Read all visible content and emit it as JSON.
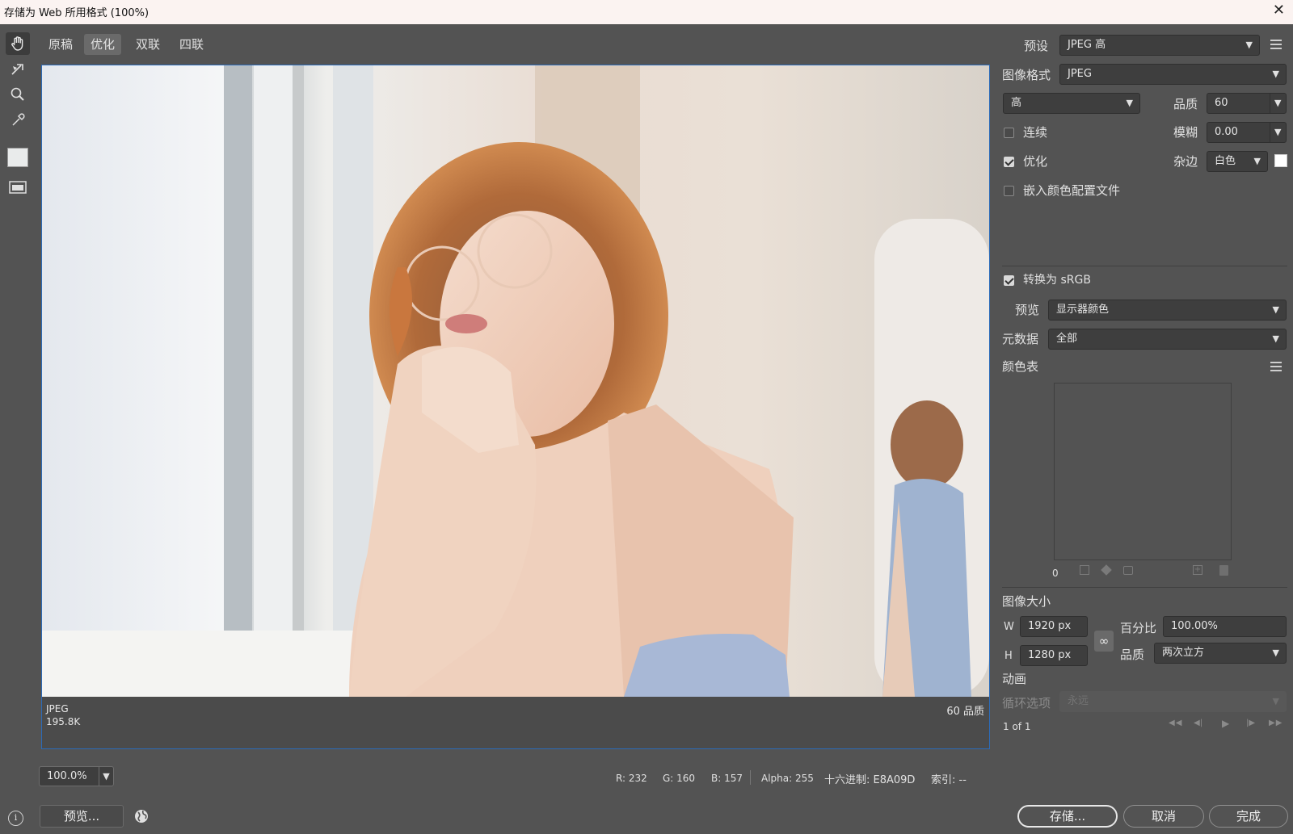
{
  "window": {
    "title": "存储为 Web 所用格式 (100%)",
    "close": "✕"
  },
  "tabs": [
    "原稿",
    "优化",
    "双联",
    "四联"
  ],
  "tools": [
    "hand-icon",
    "slice-select-icon",
    "zoom-icon",
    "eyedropper-icon",
    "eyedropper-color-icon",
    "toggle-slices-icon"
  ],
  "preview": {
    "format": "JPEG",
    "size": "195.8K",
    "quality_text": "60 品质"
  },
  "zoom": {
    "value": "100.0%"
  },
  "status": {
    "r": "R: 232",
    "g": "G: 160",
    "b": "B: 157",
    "alpha": "Alpha: 255",
    "hex": "十六进制: E8A09D",
    "index": "索引: --"
  },
  "settings": {
    "preset_label": "预设",
    "preset_value": "JPEG 高",
    "format_label": "图像格式",
    "format_value": "JPEG",
    "quality_level": "高",
    "quality_label": "品质",
    "quality_value": "60",
    "blur_label": "模糊",
    "blur_value": "0.00",
    "matte_label": "杂边",
    "matte_value": "白色",
    "progressive_label": "连续",
    "progressive_checked": false,
    "optimized_label": "优化",
    "optimized_checked": true,
    "embed_profile_label": "嵌入颜色配置文件",
    "embed_profile_checked": false,
    "convert_srgb_label": "转换为 sRGB",
    "convert_srgb_checked": true,
    "preview_label": "预览",
    "preview_value": "显示器颜色",
    "metadata_label": "元数据",
    "metadata_value": "全部",
    "color_table_label": "颜色表",
    "color_table_count": "0"
  },
  "image_size": {
    "label": "图像大小",
    "w_label": "W",
    "w_value": "1920 px",
    "h_label": "H",
    "h_value": "1280 px",
    "percent_label": "百分比",
    "percent_value": "100.00%",
    "quality_label": "品质",
    "quality_value": "两次立方"
  },
  "animation": {
    "label": "动画",
    "loop_label": "循环选项",
    "loop_value": "永远",
    "frame": "1 of 1"
  },
  "buttons": {
    "preview": "预览...",
    "save": "存储...",
    "cancel": "取消",
    "done": "完成"
  }
}
